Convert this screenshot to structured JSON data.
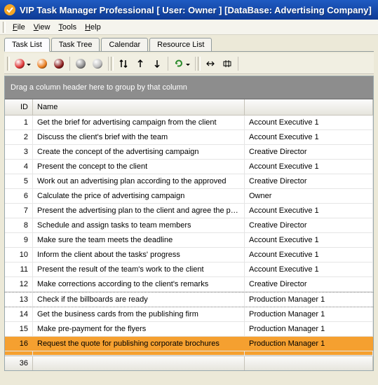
{
  "window": {
    "title": "VIP Task Manager Professional [ User: Owner ] [DataBase: Advertising Company]"
  },
  "menu": {
    "file": "File",
    "view": "View",
    "tools": "Tools",
    "help": "Help"
  },
  "tabs": {
    "task_list": "Task List",
    "task_tree": "Task Tree",
    "calendar": "Calendar",
    "resource_list": "Resource List"
  },
  "grid": {
    "group_hint": "Drag a column header here to group by that column",
    "col_id": "ID",
    "col_name": "Name",
    "rows": [
      {
        "id": 1,
        "name": "Get the brief for advertising campaign from the client",
        "assignee": "Account Executive 1"
      },
      {
        "id": 2,
        "name": "Discuss the client's brief with the team",
        "assignee": "Account Executive 1"
      },
      {
        "id": 3,
        "name": "Create the concept of the advertising campaign",
        "assignee": "Creative Director"
      },
      {
        "id": 4,
        "name": "Present the concept to the client",
        "assignee": "Account Executive 1"
      },
      {
        "id": 5,
        "name": "Work out an advertising plan according to the approved",
        "assignee": "Creative Director"
      },
      {
        "id": 6,
        "name": "Calculate the price of advertising campaign",
        "assignee": "Owner"
      },
      {
        "id": 7,
        "name": "Present the advertising plan to the client and agree the price",
        "assignee": "Account Executive 1"
      },
      {
        "id": 8,
        "name": "Schedule and assign tasks to team members",
        "assignee": "Creative Director"
      },
      {
        "id": 9,
        "name": "Make sure the team meets the deadline",
        "assignee": "Account Executive 1"
      },
      {
        "id": 10,
        "name": "Inform the client about the tasks' progress",
        "assignee": "Account Executive 1"
      },
      {
        "id": 11,
        "name": "Present the result of the team's work to the client",
        "assignee": "Account Executive 1"
      },
      {
        "id": 12,
        "name": "Make corrections according to the client's remarks",
        "assignee": "Creative Director"
      },
      {
        "id": 13,
        "name": "Check if the billboards are ready",
        "assignee": "Production Manager 1"
      },
      {
        "id": 14,
        "name": "Get the business cards from the publishing firm",
        "assignee": "Production Manager 1"
      },
      {
        "id": 15,
        "name": "Make pre-payment for the flyers",
        "assignee": "Production Manager 1"
      },
      {
        "id": 16,
        "name": "Request the quote for publishing corporate brochures",
        "assignee": "Production Manager 1"
      }
    ],
    "footer_count": "36"
  }
}
